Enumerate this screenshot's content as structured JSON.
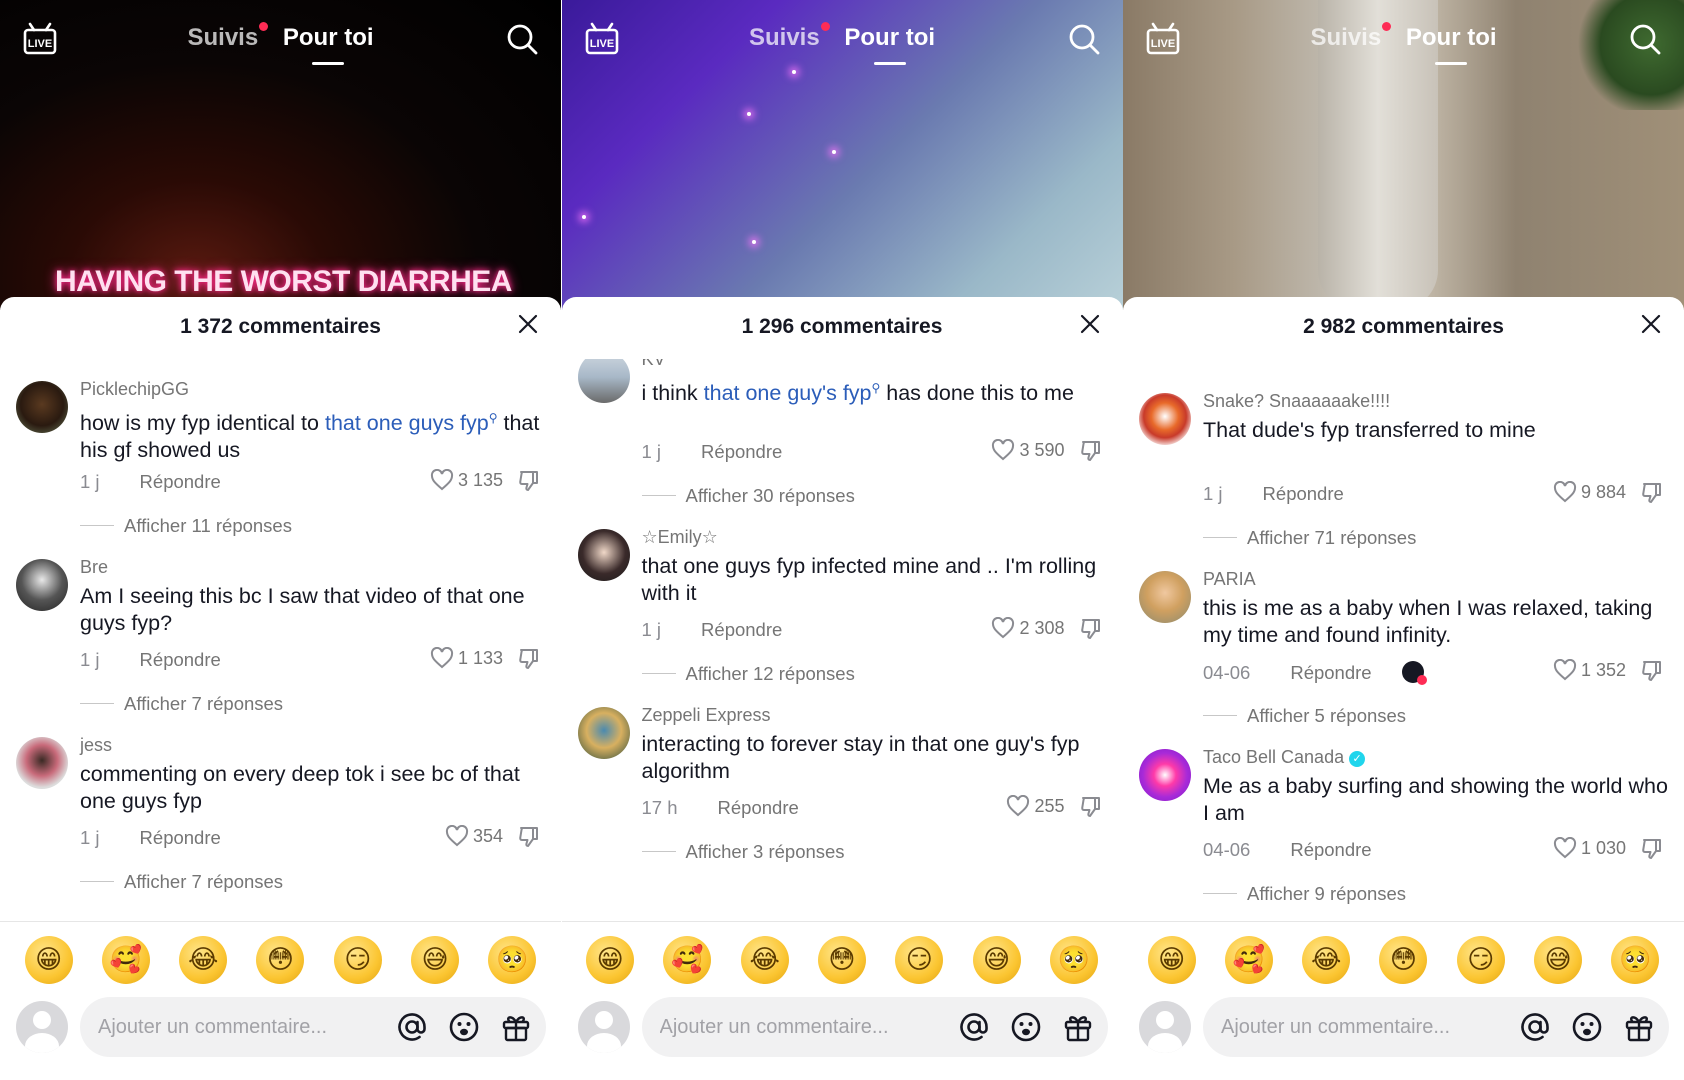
{
  "nav": {
    "live_label": "LIVE",
    "following": "Suivis",
    "for_you": "Pour toi"
  },
  "panels": [
    {
      "video_caption": "HAVING THE WORST DIARRHEA",
      "comment_count": "1 372 commentaires",
      "comments": [
        {
          "username": "PicklechipGG",
          "text_before": "how is my fyp identical to ",
          "highlight": "that one guys fyp",
          "text_after": " that his gf showed us",
          "age": "1 j",
          "reply": "Répondre",
          "likes": "3 135",
          "more": "Afficher 11 réponses"
        },
        {
          "username": "Bre",
          "text_before": "Am I seeing this bc I saw that video of that one guys fyp?",
          "highlight": "",
          "text_after": "",
          "age": "1 j",
          "reply": "Répondre",
          "likes": "1 133",
          "more": "Afficher 7 réponses"
        },
        {
          "username": "jess",
          "text_before": "commenting on every deep tok i see bc of that one guys fyp",
          "highlight": "",
          "text_after": "",
          "age": "1 j",
          "reply": "Répondre",
          "likes": "354",
          "more": "Afficher 7 réponses"
        }
      ]
    },
    {
      "video_caption": "",
      "comment_count": "1 296 commentaires",
      "comments": [
        {
          "username": "KV",
          "text_before": "i think ",
          "highlight": "that one guy's fyp",
          "text_after": " has done this to me",
          "age": "1 j",
          "reply": "Répondre",
          "likes": "3 590",
          "more": "Afficher 30 réponses"
        },
        {
          "username": "☆Emily☆",
          "text_before": "that one guys fyp infected mine and .. I'm rolling with it",
          "highlight": "",
          "text_after": "",
          "age": "1 j",
          "reply": "Répondre",
          "likes": "2 308",
          "more": "Afficher 12 réponses"
        },
        {
          "username": "Zeppeli Express",
          "text_before": "interacting to forever stay in that one guy's fyp algorithm",
          "highlight": "",
          "text_after": "",
          "age": "17 h",
          "reply": "Répondre",
          "likes": "255",
          "more": "Afficher 3 réponses"
        }
      ]
    },
    {
      "video_caption": "",
      "comment_count": "2 982 commentaires",
      "comments": [
        {
          "username": "Snake? Snaaaaaake!!!!",
          "text_before": "That dude's fyp transferred to mine",
          "highlight": "",
          "text_after": "",
          "age": "1 j",
          "reply": "Répondre",
          "likes": "9 884",
          "more": "Afficher 71 réponses"
        },
        {
          "username": "PARIA",
          "text_before": "this is me as a baby when I was relaxed, taking my time and found infinity.",
          "highlight": "",
          "text_after": "",
          "age": "04-06",
          "reply": "Répondre",
          "likes": "1 352",
          "more": "Afficher 5 réponses"
        },
        {
          "username": "Taco Bell Canada",
          "text_before": "Me as a baby surfing and showing the world who I am",
          "highlight": "",
          "text_after": "",
          "age": "04-06",
          "reply": "Répondre",
          "likes": "1 030",
          "more": "Afficher 9 réponses"
        }
      ]
    }
  ],
  "emojis": [
    "😁",
    "🥰",
    "😂",
    "😳",
    "😏",
    "😅",
    "🥺"
  ],
  "input": {
    "placeholder": "Ajouter un commentaire..."
  },
  "icons": [
    "live-icon",
    "search-icon",
    "close-icon",
    "heart-icon",
    "dislike-icon",
    "at-icon",
    "emoji-icon",
    "gift-icon"
  ],
  "colors": {
    "accent": "#fe2c55",
    "link": "#2b5db9",
    "muted": "#757575"
  }
}
